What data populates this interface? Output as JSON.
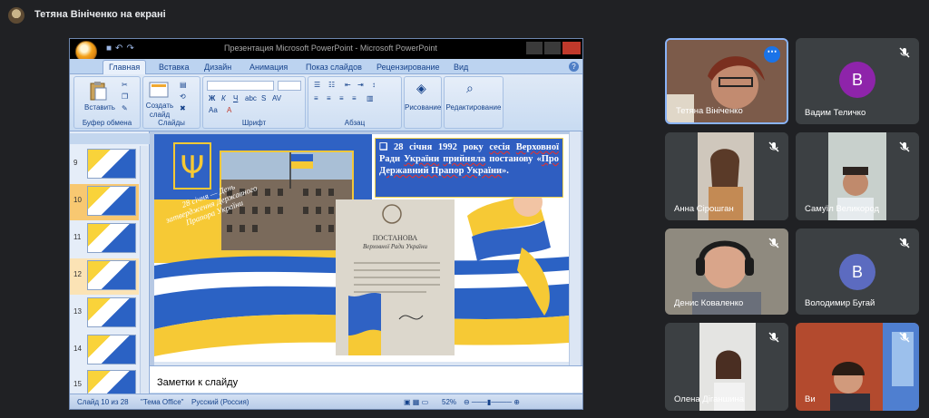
{
  "meet": {
    "presenter_title": "Тетяна Вініченко на екрані",
    "participants": [
      {
        "name": "Тетяна Вініченко",
        "kind": "video",
        "active": true
      },
      {
        "name": "Вадим Теличко",
        "kind": "avatar",
        "initial": "В",
        "color": "#8e24aa"
      },
      {
        "name": "Анна Сірошган",
        "kind": "video"
      },
      {
        "name": "Самуїл Великород",
        "kind": "video"
      },
      {
        "name": "Денис Коваленко",
        "kind": "video"
      },
      {
        "name": "Володимир Бугай",
        "kind": "avatar",
        "initial": "В",
        "color": "#5c6bc0"
      },
      {
        "name": "Олена Діганшина",
        "kind": "video"
      },
      {
        "name": "Ви",
        "kind": "video"
      }
    ]
  },
  "ppt": {
    "window_title": "Презентация Microsoft PowerPoint - Microsoft PowerPoint",
    "tabs": [
      "Главная",
      "Вставка",
      "Дизайн",
      "Анимация",
      "Показ слайдов",
      "Рецензирование",
      "Вид"
    ],
    "groups": {
      "clipboard": "Буфер обмена",
      "slides": "Слайды",
      "font": "Шрифт",
      "paragraph": "Абзац"
    },
    "buttons": {
      "paste": "Вставить",
      "new_slide_1": "Создать",
      "new_slide_2": "слайд",
      "drawing": "Рисование",
      "editing": "Редактирование"
    },
    "thumbnail_numbers": [
      "9",
      "10",
      "11",
      "12",
      "13",
      "14",
      "15"
    ],
    "slide": {
      "right_text_parts": [
        "28 січня 1992 року ",
        "сесія",
        " ",
        "Верховної",
        " Ради ",
        "України",
        " ",
        "прийняла",
        " постанову «",
        "Про Державний Прапор України",
        "»."
      ],
      "diagonal_text": "28 січня — День затвердження Державного Прапора України",
      "doc_title": "ПОСТАНОВА",
      "doc_subtitle": "Верховної Ради України"
    },
    "notes_placeholder": "Заметки к слайду",
    "status": {
      "slide_counter": "Слайд 10 из 28",
      "theme": "\"Тема Office\"",
      "language": "Русский (Россия)",
      "zoom": "52%"
    }
  }
}
